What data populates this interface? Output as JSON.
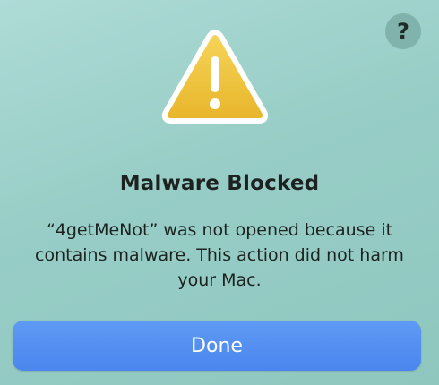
{
  "dialog": {
    "help_label": "?",
    "icon": "warning-icon",
    "title": "Malware Blocked",
    "message": "“4getMeNot” was not opened because it contains malware. This action did not harm your Mac.",
    "done_label": "Done"
  },
  "colors": {
    "background": "#9fd2cb",
    "help_button": "#7fb3ac",
    "warning_fill": "#f2c234",
    "warning_border": "#ffffff",
    "exclamation": "#ffffff",
    "primary_button": "#4f8ef0"
  }
}
